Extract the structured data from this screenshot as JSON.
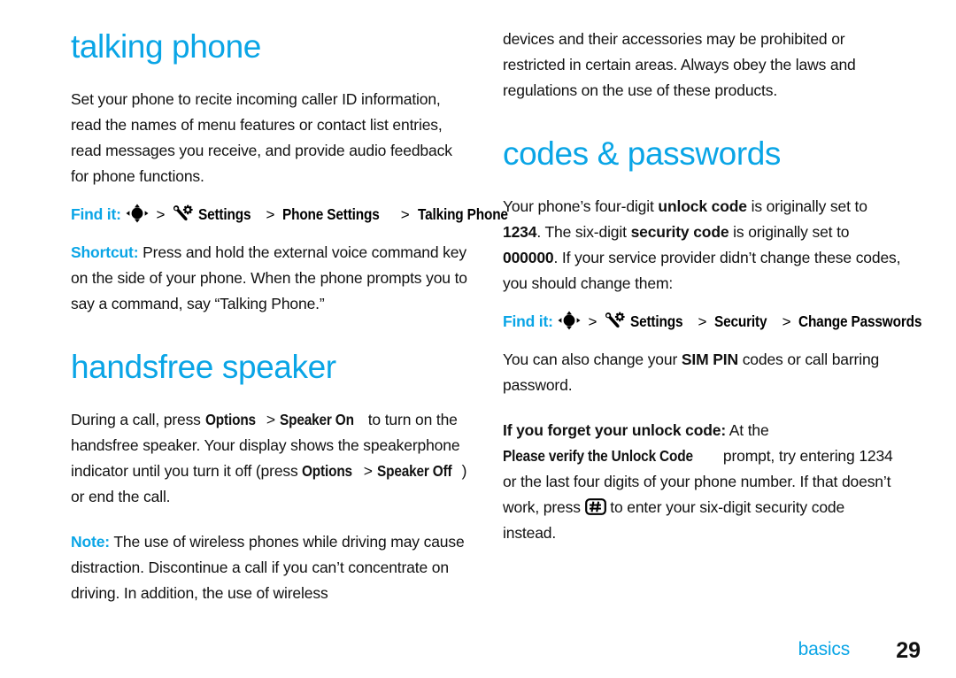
{
  "page": {
    "accent_color": "#0aa5e6",
    "text_color": "#111111",
    "background": "#ffffff"
  },
  "footer": {
    "section": "basics",
    "page_number": "29"
  },
  "left_column": {
    "heading": "talking phone",
    "intro": "Set your phone to recite incoming caller ID information, read the names of menu features or contact list entries, read messages you receive, and provide audio feedback for phone functions.",
    "find_it": {
      "label": "Find it:",
      "nav_icon": "navigation-key-icon",
      "settings_icon": "settings-wrench-gear-icon",
      "separator": ">",
      "path": [
        "Settings",
        "Phone Settings",
        "Talking Phone"
      ]
    },
    "shortcut": {
      "label": "Shortcut:",
      "text": "Press and hold the external voice command key on the side of your phone. When the phone prompts you to say a command, say “Talking Phone.”"
    },
    "heading2": "handsfree speaker",
    "speaker_para": {
      "p1": "During a call, press ",
      "menu1": "Options",
      "sep1": " > ",
      "menu2": "Speaker On",
      "p2": " to turn on the handsfree speaker. Your display shows the speakerphone indicator until you turn it off (press ",
      "menu3": "Options",
      "sep2": " > ",
      "menu4": "Speaker Off",
      "p3": ") or end the call."
    },
    "note": {
      "label": "Note:",
      "text": "The use of wireless phones while driving may cause distraction. Discontinue a call if you can’t concentrate on driving. In addition, the use of wireless"
    }
  },
  "right_column": {
    "continuation": "devices and their accessories may be prohibited or restricted in certain areas. Always obey the laws and regulations on the use of these products.",
    "heading": "codes & passwords",
    "codes_para": {
      "p1": "Your phone’s four-digit ",
      "b1": "unlock code",
      "p2": " is originally set to ",
      "b2": "1234",
      "p3": ". The six-digit ",
      "b3": "security code",
      "p4": " is originally set to ",
      "b4": "000000",
      "p5": ". If your service provider didn’t change these codes, you should change them:"
    },
    "find_it": {
      "label": "Find it:",
      "nav_icon": "navigation-key-icon",
      "settings_icon": "settings-wrench-gear-icon",
      "separator": ">",
      "path": [
        "Settings",
        "Security",
        "Change Passwords"
      ]
    },
    "sim_para": {
      "p1": "You can also change your ",
      "b1": "SIM PIN",
      "p2": " codes or call barring password."
    },
    "forget_para": {
      "b1": "If you forget your unlock code:",
      "p1": " At the ",
      "menu1": "Please verify the Unlock Code",
      "p2": " prompt, try entering 1234 or the last four digits of your phone number. If that doesn’t work, press ",
      "key_icon": "hash-key-icon",
      "p3": " to enter your six-digit security code instead."
    }
  }
}
